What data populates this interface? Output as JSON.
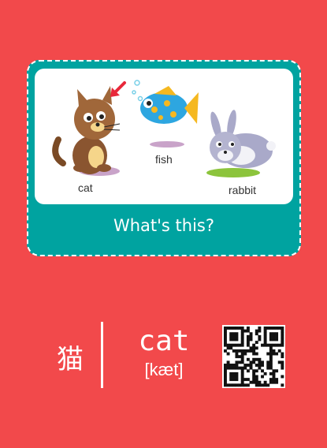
{
  "card": {
    "caption": "What's this?",
    "animals": [
      {
        "label": "cat",
        "icon": "cat-illustration"
      },
      {
        "label": "fish",
        "icon": "fish-illustration"
      },
      {
        "label": "rabbit",
        "icon": "rabbit-illustration"
      }
    ],
    "pointer_icon": "red-arrow-icon"
  },
  "vocab": {
    "chinese": "猫",
    "word": "cat",
    "phonetic": "[kæt]",
    "qr_icon": "qr-code"
  },
  "colors": {
    "background": "#f2494b",
    "card": "#00a3a0",
    "text": "#ffffff"
  }
}
